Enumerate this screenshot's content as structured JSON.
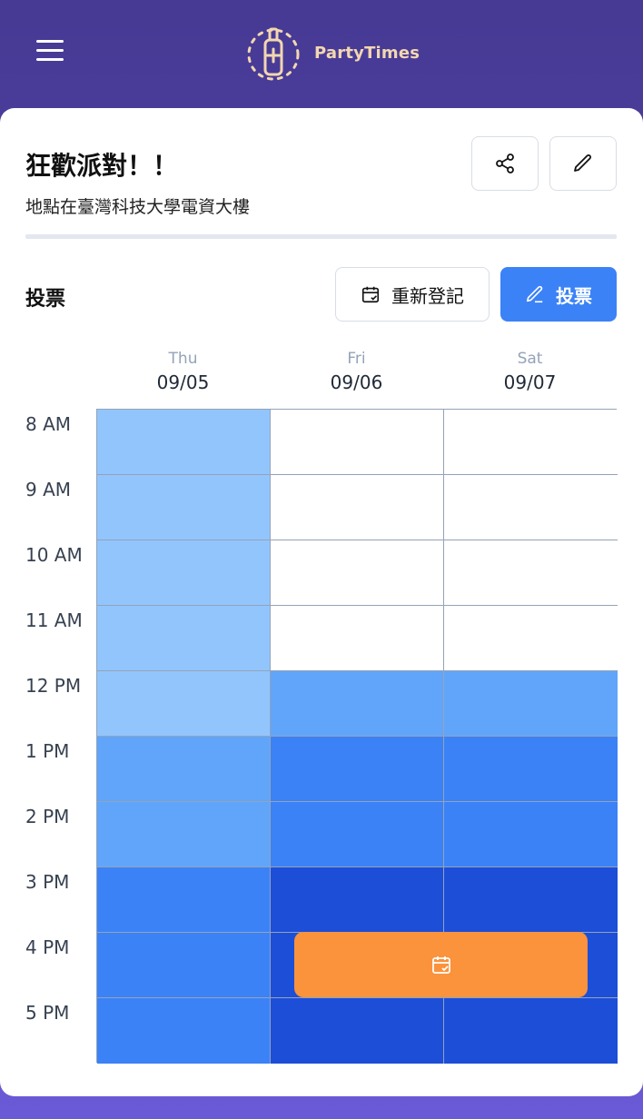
{
  "header": {
    "brand": "PartyTimes",
    "menu_icon": "hamburger-menu-icon",
    "logo_icon": "champagne-bottle-icon"
  },
  "event": {
    "title": "狂歡派對！！",
    "location": "地點在臺灣科技大學電資大樓"
  },
  "actions": {
    "share_icon": "share-icon",
    "edit_icon": "pencil-icon"
  },
  "vote": {
    "label": "投票",
    "register_label": "重新登記",
    "vote_label": "投票"
  },
  "days": [
    {
      "name": "Thu",
      "date": "09/05"
    },
    {
      "name": "Fri",
      "date": "09/06"
    },
    {
      "name": "Sat",
      "date": "09/07"
    }
  ],
  "times": [
    "8 AM",
    "9 AM",
    "10 AM",
    "11 AM",
    "12 PM",
    "1 PM",
    "2 PM",
    "3 PM",
    "4 PM",
    "5 PM"
  ],
  "availability_levels": [
    [
      1,
      0,
      0
    ],
    [
      1,
      0,
      0
    ],
    [
      1,
      0,
      0
    ],
    [
      1,
      0,
      0
    ],
    [
      1,
      2,
      2
    ],
    [
      2,
      3,
      3
    ],
    [
      2,
      3,
      3
    ],
    [
      3,
      4,
      4
    ],
    [
      3,
      4,
      4
    ],
    [
      3,
      4,
      4
    ]
  ],
  "level_colors": [
    "#ffffff",
    "#93c5fd",
    "#60a5fa",
    "#3b82f6",
    "#1d4ed8"
  ],
  "scheduled_event": {
    "icon": "calendar-check-icon",
    "color": "#fb923c"
  }
}
